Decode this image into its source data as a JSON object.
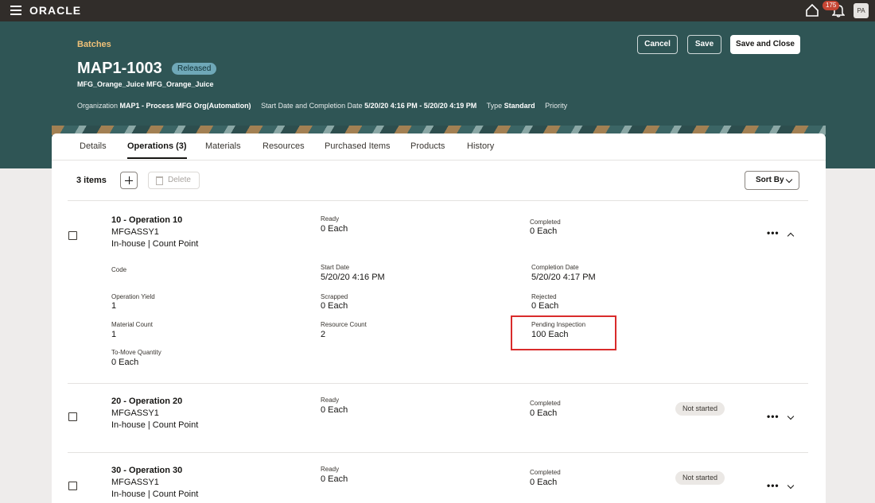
{
  "app": {
    "logo": "ORACLE",
    "notification_count": "175",
    "user_initials": "PA"
  },
  "header": {
    "breadcrumb": "Batches",
    "title": "MAP1-1003",
    "status": "Released",
    "subtitle": "MFG_Orange_Juice MFG_Orange_Juice",
    "org_label": "Organization",
    "org_value": "MAP1 - Process MFG Org(Automation)",
    "dates_label": "Start Date and Completion Date",
    "dates_value": "5/20/20 4:16 PM - 5/20/20 4:19 PM",
    "type_label": "Type",
    "type_value": "Standard",
    "priority_label": "Priority",
    "buttons": {
      "cancel": "Cancel",
      "save": "Save",
      "save_close": "Save and Close"
    }
  },
  "tabs": [
    "Details",
    "Operations (3)",
    "Materials",
    "Resources",
    "Purchased Items",
    "Products",
    "History"
  ],
  "toolbar": {
    "count": "3 items",
    "delete": "Delete",
    "sort": "Sort By"
  },
  "operations": [
    {
      "title": "10 - Operation 10",
      "resource": "MFGASSY1",
      "info": "In-house | Count Point",
      "ready_label": "Ready",
      "ready_value": "0 Each",
      "completed_label": "Completed",
      "completed_value": "0 Each",
      "details": {
        "code_label": "Code",
        "start_label": "Start Date",
        "start_value": "5/20/20 4:16 PM",
        "completion_label": "Completion Date",
        "completion_value": "5/20/20 4:17 PM",
        "yield_label": "Operation Yield",
        "yield_value": "1",
        "scrapped_label": "Scrapped",
        "scrapped_value": "0 Each",
        "rejected_label": "Rejected",
        "rejected_value": "0 Each",
        "material_label": "Material Count",
        "material_value": "1",
        "resource_label": "Resource Count",
        "resource_value": "2",
        "pending_label": "Pending Inspection",
        "pending_value": "100 Each",
        "tomove_label": "To-Move Quantity",
        "tomove_value": "0 Each"
      }
    },
    {
      "title": "20 - Operation 20",
      "resource": "MFGASSY1",
      "info": "In-house | Count Point",
      "ready_label": "Ready",
      "ready_value": "0 Each",
      "completed_label": "Completed",
      "completed_value": "0 Each",
      "status": "Not started"
    },
    {
      "title": "30 - Operation 30",
      "resource": "MFGASSY1",
      "info": "In-house | Count Point",
      "ready_label": "Ready",
      "ready_value": "0 Each",
      "completed_label": "Completed",
      "completed_value": "0 Each",
      "status": "Not started"
    }
  ]
}
